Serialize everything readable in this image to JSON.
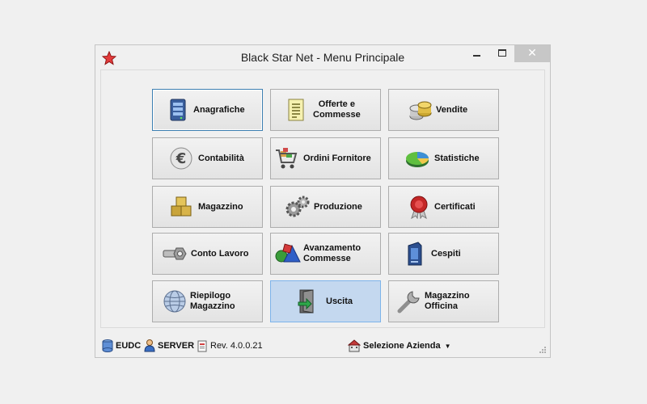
{
  "window": {
    "title": "Black Star Net - Menu Principale",
    "close_symbol": "✕"
  },
  "menu": {
    "anagrafiche": "Anagrafiche",
    "offerte": "Offerte e\nCommesse",
    "vendite": "Vendite",
    "contabilita": "Contabilità",
    "ordini": "Ordini Fornitore",
    "statistiche": "Statistiche",
    "magazzino": "Magazzino",
    "produzione": "Produzione",
    "certificati": "Certificati",
    "conto_lavoro": "Conto Lavoro",
    "avanzamento": "Avanzamento\nCommesse",
    "cespiti": "Cespiti",
    "riepilogo": "Riepilogo\nMagazzino",
    "uscita": "Uscita",
    "magazzino_officina": "Magazzino\nOfficina"
  },
  "statusbar": {
    "database": "EUDC",
    "user": "SERVER",
    "revision": "Rev. 4.0.0.21",
    "company_selector": "Selezione Azienda"
  },
  "icons": {
    "app": "red-star-icon",
    "anagrafiche": "server-cabinet-icon",
    "offerte": "document-list-icon",
    "vendite": "coins-icon",
    "contabilita": "euro-icon",
    "ordini": "shopping-cart-icon",
    "statistiche": "pie-chart-icon",
    "magazzino": "boxes-icon",
    "produzione": "gears-icon",
    "certificati": "wax-seal-icon",
    "conto_lavoro": "bolt-nut-icon",
    "avanzamento": "shapes-icon",
    "cespiti": "tower-device-icon",
    "riepilogo": "globe-icon",
    "uscita": "exit-door-icon",
    "magazzino_officina": "wrench-icon"
  }
}
